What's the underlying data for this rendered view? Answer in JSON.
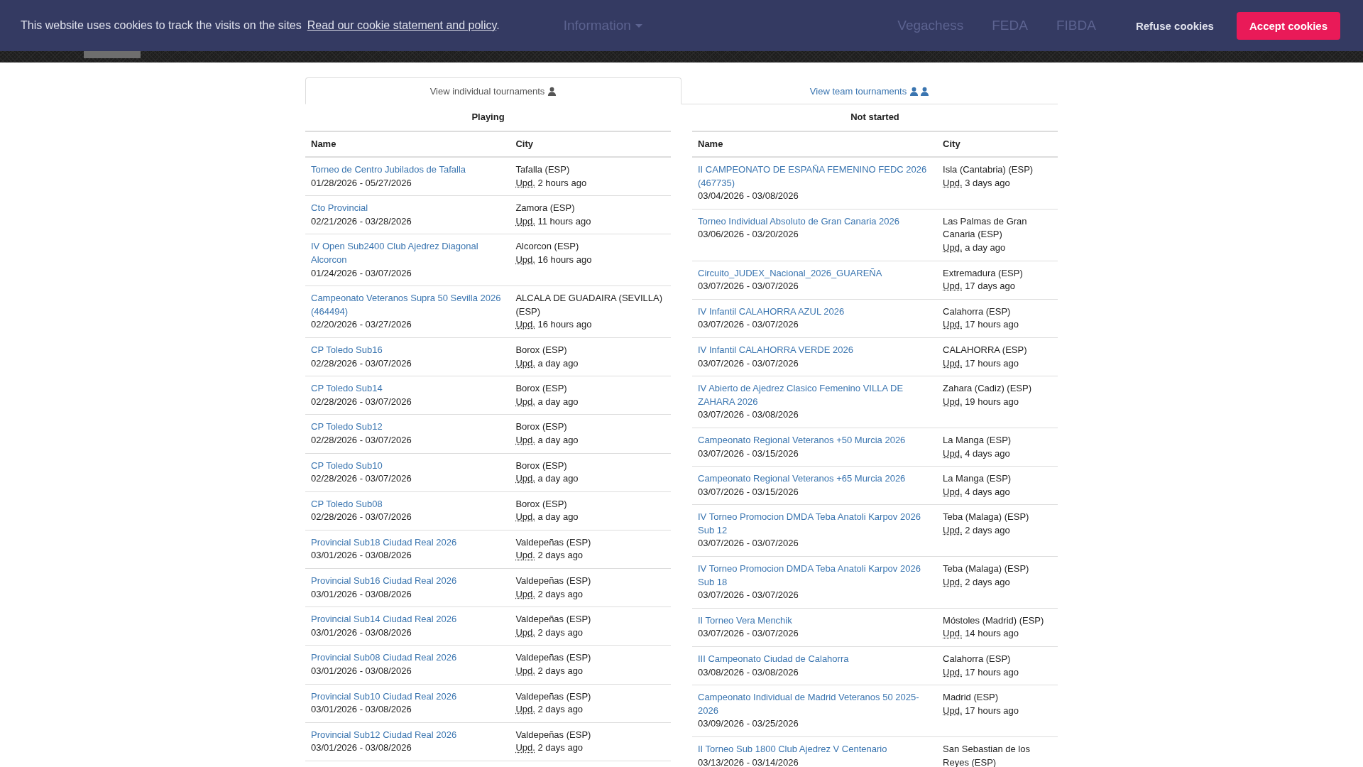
{
  "cookie_banner": {
    "message": "This website uses cookies to track the visits on the sites",
    "link": "Read our cookie statement and policy",
    "trailing": ".",
    "buttons": [
      {
        "label": "Refuse cookies",
        "kind": "refuse"
      },
      {
        "label": "Accept cookies",
        "kind": "accept"
      }
    ]
  },
  "nav": {
    "center_items": [
      {
        "label": "Information",
        "dropdown": true
      }
    ],
    "right_items": [
      {
        "label": "Vegachess"
      },
      {
        "label": "FEDA"
      },
      {
        "label": "FIBDA"
      }
    ]
  },
  "tabs": [
    {
      "label": "View individual tournaments",
      "kind": "individual",
      "selected": true
    },
    {
      "label": "View team tournaments",
      "kind": "team",
      "selected": false
    }
  ],
  "tables": [
    {
      "title": "Playing",
      "columns": [
        "Name",
        "City"
      ],
      "rows": [
        {
          "name": "Torneo de Centro Jubilados de Tafalla",
          "dates": "01/28/2026 - 05/27/2026",
          "city": "Tafalla (ESP)",
          "upd": "Upd.",
          "updated": "2 hours ago"
        },
        {
          "name": "Cto Provincial",
          "dates": "02/21/2026 - 03/28/2026",
          "city": "Zamora (ESP)",
          "upd": "Upd.",
          "updated": "11 hours ago"
        },
        {
          "name": "IV Open Sub2400 Club Ajedrez Diagonal Alcorcon",
          "dates": "01/24/2026 - 03/07/2026",
          "city": "Alcorcon (ESP)",
          "upd": "Upd.",
          "updated": "16 hours ago"
        },
        {
          "name": "Campeonato Veteranos Supra 50 Sevilla 2026 (464494)",
          "dates": "02/20/2026 - 03/27/2026",
          "city": "ALCALA DE GUADAIRA (SEVILLA) (ESP)",
          "upd": "Upd.",
          "updated": "16 hours ago"
        },
        {
          "name": "CP Toledo Sub16",
          "dates": "02/28/2026 - 03/07/2026",
          "city": "Borox (ESP)",
          "upd": "Upd.",
          "updated": "a day ago"
        },
        {
          "name": "CP Toledo Sub14",
          "dates": "02/28/2026 - 03/07/2026",
          "city": "Borox (ESP)",
          "upd": "Upd.",
          "updated": "a day ago"
        },
        {
          "name": "CP Toledo Sub12",
          "dates": "02/28/2026 - 03/07/2026",
          "city": "Borox (ESP)",
          "upd": "Upd.",
          "updated": "a day ago"
        },
        {
          "name": "CP Toledo Sub10",
          "dates": "02/28/2026 - 03/07/2026",
          "city": "Borox (ESP)",
          "upd": "Upd.",
          "updated": "a day ago"
        },
        {
          "name": "CP Toledo Sub08",
          "dates": "02/28/2026 - 03/07/2026",
          "city": "Borox (ESP)",
          "upd": "Upd.",
          "updated": "a day ago"
        },
        {
          "name": "Provincial Sub18 Ciudad Real 2026",
          "dates": "03/01/2026 - 03/08/2026",
          "city": "Valdepeñas (ESP)",
          "upd": "Upd.",
          "updated": "2 days ago"
        },
        {
          "name": "Provincial Sub16 Ciudad Real 2026",
          "dates": "03/01/2026 - 03/08/2026",
          "city": "Valdepeñas (ESP)",
          "upd": "Upd.",
          "updated": "2 days ago"
        },
        {
          "name": "Provincial Sub14 Ciudad Real 2026",
          "dates": "03/01/2026 - 03/08/2026",
          "city": "Valdepeñas (ESP)",
          "upd": "Upd.",
          "updated": "2 days ago"
        },
        {
          "name": "Provincial Sub08 Ciudad Real 2026",
          "dates": "03/01/2026 - 03/08/2026",
          "city": "Valdepeñas (ESP)",
          "upd": "Upd.",
          "updated": "2 days ago"
        },
        {
          "name": "Provincial Sub10 Ciudad Real 2026",
          "dates": "03/01/2026 - 03/08/2026",
          "city": "Valdepeñas (ESP)",
          "upd": "Upd.",
          "updated": "2 days ago"
        },
        {
          "name": "Provincial Sub12 Ciudad Real 2026",
          "dates": "03/01/2026 - 03/08/2026",
          "city": "Valdepeñas (ESP)",
          "upd": "Upd.",
          "updated": "2 days ago"
        }
      ]
    },
    {
      "title": "Not started",
      "columns": [
        "Name",
        "City"
      ],
      "rows": [
        {
          "name": "II CAMPEONATO DE ESPAÑA FEMENINO FEDC 2026 (467735)",
          "dates": "03/04/2026 - 03/08/2026",
          "city": "Isla (Cantabria) (ESP)",
          "upd": "Upd.",
          "updated": "3 days ago"
        },
        {
          "name": "Torneo Individual Absoluto de Gran Canaria 2026",
          "dates": "03/06/2026 - 03/20/2026",
          "city": "Las Palmas de Gran Canaria (ESP)",
          "upd": "Upd.",
          "updated": "a day ago"
        },
        {
          "name": "Circuito_JUDEX_Nacional_2026_GUAREÑA",
          "dates": "03/07/2026 - 03/07/2026",
          "city": "Extremadura (ESP)",
          "upd": "Upd.",
          "updated": "17 days ago"
        },
        {
          "name": "IV Infantil CALAHORRA AZUL 2026",
          "dates": "03/07/2026 - 03/07/2026",
          "city": "Calahorra (ESP)",
          "upd": "Upd.",
          "updated": "17 hours ago"
        },
        {
          "name": "IV Infantil CALAHORRA VERDE 2026",
          "dates": "03/07/2026 - 03/07/2026",
          "city": "CALAHORRA (ESP)",
          "upd": "Upd.",
          "updated": "17 hours ago"
        },
        {
          "name": "IV Abierto de Ajedrez Clasico Femenino VILLA DE ZAHARA 2026",
          "dates": "03/07/2026 - 03/08/2026",
          "city": "Zahara (Cadiz) (ESP)",
          "upd": "Upd.",
          "updated": "19 hours ago"
        },
        {
          "name": "Campeonato Regional Veteranos +50 Murcia 2026",
          "dates": "03/07/2026 - 03/15/2026",
          "city": "La Manga (ESP)",
          "upd": "Upd.",
          "updated": "4 days ago"
        },
        {
          "name": "Campeonato Regional Veteranos +65 Murcia 2026",
          "dates": "03/07/2026 - 03/15/2026",
          "city": "La Manga (ESP)",
          "upd": "Upd.",
          "updated": "4 days ago"
        },
        {
          "name": "IV Torneo Promocion DMDA Teba Anatoli Karpov 2026 Sub 12",
          "dates": "03/07/2026 - 03/07/2026",
          "city": "Teba (Malaga) (ESP)",
          "upd": "Upd.",
          "updated": "2 days ago"
        },
        {
          "name": "IV Torneo Promocion DMDA Teba Anatoli Karpov 2026 Sub 18",
          "dates": "03/07/2026 - 03/07/2026",
          "city": "Teba (Malaga) (ESP)",
          "upd": "Upd.",
          "updated": "2 days ago"
        },
        {
          "name": "II Torneo Vera Menchik",
          "dates": "03/07/2026 - 03/07/2026",
          "city": "Móstoles (Madrid) (ESP)",
          "upd": "Upd.",
          "updated": "14 hours ago"
        },
        {
          "name": "III Campeonato Ciudad de Calahorra",
          "dates": "03/08/2026 - 03/08/2026",
          "city": "Calahorra (ESP)",
          "upd": "Upd.",
          "updated": "17 hours ago"
        },
        {
          "name": "Campeonato Individual de Madrid Veteranos 50 2025-2026",
          "dates": "03/09/2026 - 03/25/2026",
          "city": "Madrid (ESP)",
          "upd": "Upd.",
          "updated": "17 hours ago"
        },
        {
          "name": "II Torneo Sub 1800 Club Ajedrez V Centenario",
          "dates": "03/13/2026 - 03/14/2026",
          "city": "San Sebastian de los Reyes (ESP)"
        }
      ]
    }
  ]
}
